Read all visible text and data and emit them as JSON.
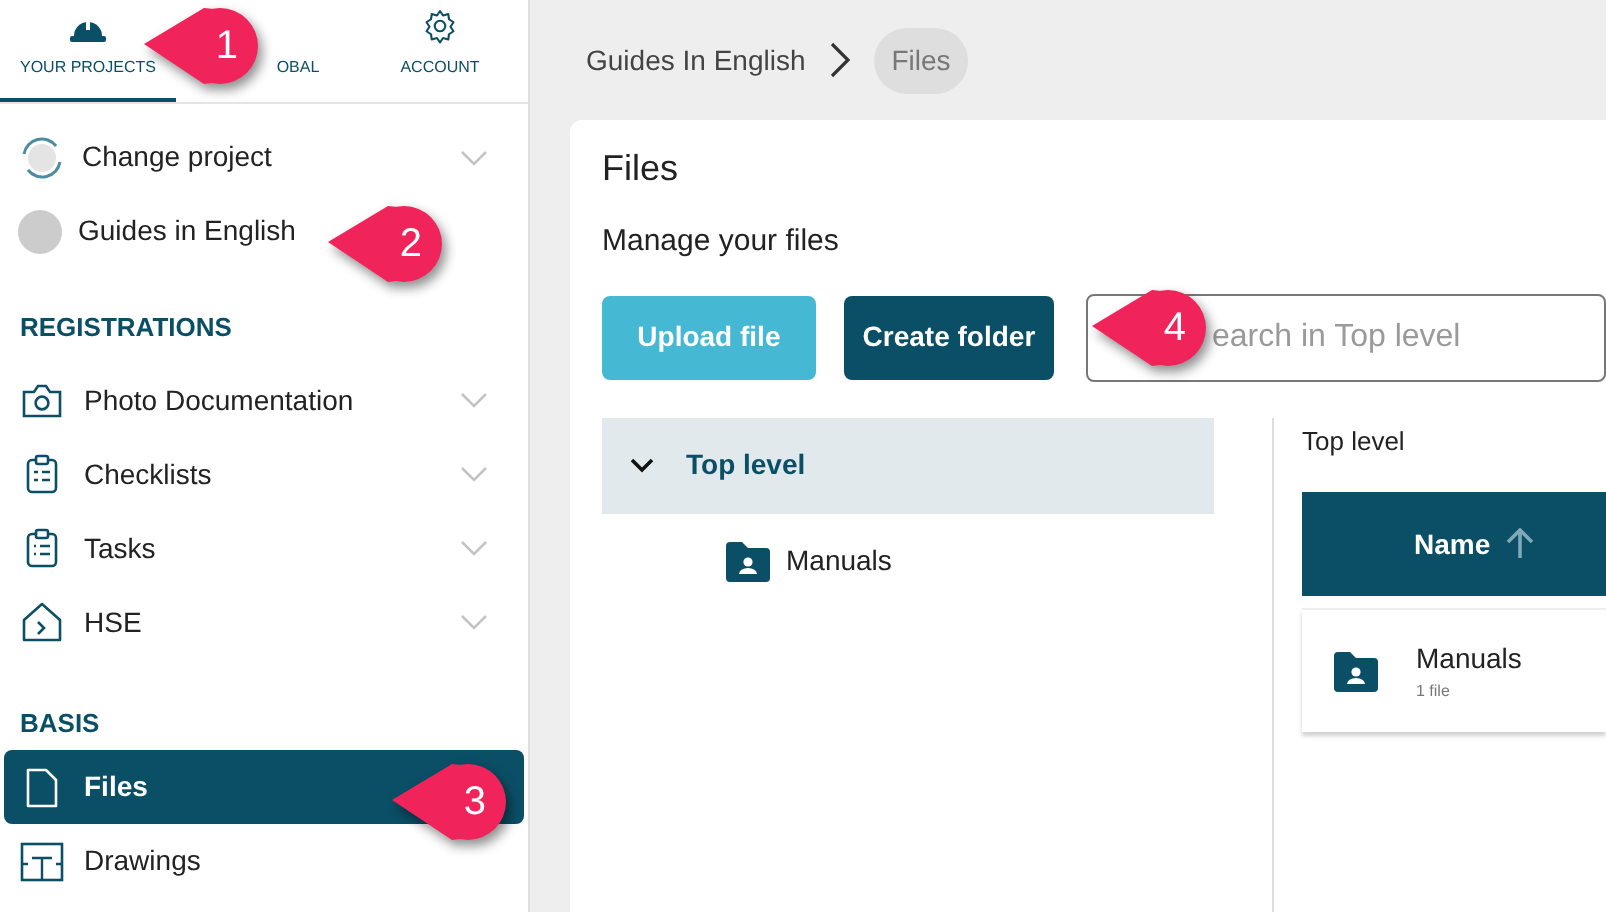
{
  "top_tabs": [
    {
      "label": "YOUR PROJECTS",
      "selected": true
    },
    {
      "label": "OBAL",
      "selected": false
    },
    {
      "label": "ACCOUNT",
      "selected": false
    }
  ],
  "project_items": [
    {
      "label": "Change project",
      "has_submenu": true
    },
    {
      "label": "Guides in English",
      "has_submenu": false
    }
  ],
  "sections": [
    {
      "title": "REGISTRATIONS",
      "items": [
        {
          "label": "Photo Documentation",
          "has_submenu": true,
          "selected": false
        },
        {
          "label": "Checklists",
          "has_submenu": true,
          "selected": false
        },
        {
          "label": "Tasks",
          "has_submenu": true,
          "selected": false
        },
        {
          "label": "HSE",
          "has_submenu": true,
          "selected": false
        }
      ]
    },
    {
      "title": "BASIS",
      "items": [
        {
          "label": "Files",
          "has_submenu": false,
          "selected": true
        },
        {
          "label": "Drawings",
          "has_submenu": false,
          "selected": false
        }
      ]
    }
  ],
  "breadcrumb": [
    {
      "label": "Guides In English",
      "selected": false
    },
    {
      "label": "Files",
      "selected": true
    }
  ],
  "page": {
    "title": "Files",
    "subtitle": "Manage your files",
    "buttons": [
      "Upload file",
      "Create folder"
    ],
    "search": {
      "placeholder": "earch in Top level"
    }
  },
  "tree": [
    {
      "label": "Top level",
      "expanded": true,
      "selected": true,
      "children": [
        {
          "label": "Manuals",
          "selected": false
        }
      ]
    }
  ],
  "listing": {
    "heading": "Top level",
    "columns": [
      {
        "label": "Name",
        "sort_ascending": true
      }
    ],
    "rows": [
      {
        "name": "Manuals",
        "detail": "1 file"
      }
    ]
  },
  "callouts": [
    "1",
    "2",
    "3",
    "4"
  ]
}
